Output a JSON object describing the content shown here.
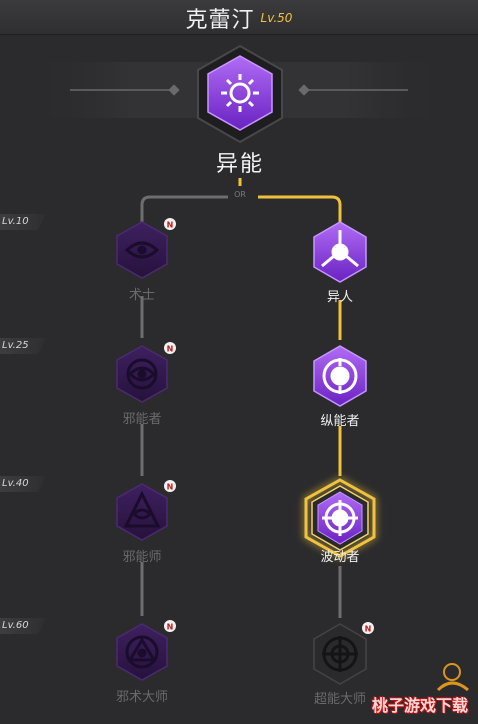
{
  "header": {
    "character_name": "克蕾汀",
    "level": "Lv.50"
  },
  "root": {
    "label": "异能",
    "or_text": "OR",
    "icon": "sun-icon"
  },
  "level_tags": [
    "Lv.10",
    "Lv.25",
    "Lv.40",
    "Lv.60"
  ],
  "left_branch": {
    "state": "locked",
    "nodes": [
      {
        "label": "术士",
        "icon": "eye-icon",
        "badge": "N"
      },
      {
        "label": "邪能者",
        "icon": "eye-icon",
        "badge": "N"
      },
      {
        "label": "邪能师",
        "icon": "pyramid-eye-icon",
        "badge": "N"
      },
      {
        "label": "邪术大师",
        "icon": "circle-eye-icon",
        "badge": "N"
      }
    ]
  },
  "right_branch": {
    "state": "active",
    "nodes": [
      {
        "label": "异人",
        "icon": "tri-split-icon",
        "state": "unlocked"
      },
      {
        "label": "纵能者",
        "icon": "ring-target-icon",
        "state": "unlocked"
      },
      {
        "label": "波动者",
        "icon": "ring-target-icon",
        "state": "current"
      },
      {
        "label": "超能大师",
        "icon": "ring-target-icon",
        "state": "locked",
        "badge": "N"
      }
    ]
  },
  "colors": {
    "accent_gold": "#f0c23c",
    "purple": "#7a2fd1",
    "purple_light": "#a35cf0",
    "locked_purple": "#3a1d5c",
    "background": "#2b2b2d"
  },
  "watermark": "桃子游戏下载"
}
